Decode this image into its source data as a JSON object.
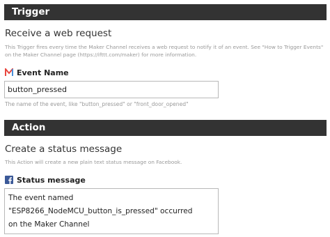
{
  "trigger": {
    "header": "Trigger",
    "title": "Receive a web request",
    "description": "This Trigger fires every time the Maker Channel receives a web request to notify it of an event. See \"How to Trigger Events\" on the Maker Channel page (https://ifttt.com/maker) for more information.",
    "field_label": "Event Name",
    "field_icon": "maker-channel-icon",
    "field_value": "button_pressed",
    "field_hint": "The name of the event, like \"button_pressed\" or \"front_door_opened\""
  },
  "action": {
    "header": "Action",
    "title": "Create a status message",
    "description": "This Action will create a new plain text status message on Facebook.",
    "field_label": "Status message",
    "field_icon": "facebook-icon",
    "field_value": "The event named\n\"ESP8266_NodeMCU_button_is_pressed\" occurred\non the Maker Channel"
  },
  "colors": {
    "header_bg": "#333333",
    "facebook_blue": "#3b5998",
    "maker_red": "#e8473f",
    "maker_blue": "#4a90d9"
  }
}
